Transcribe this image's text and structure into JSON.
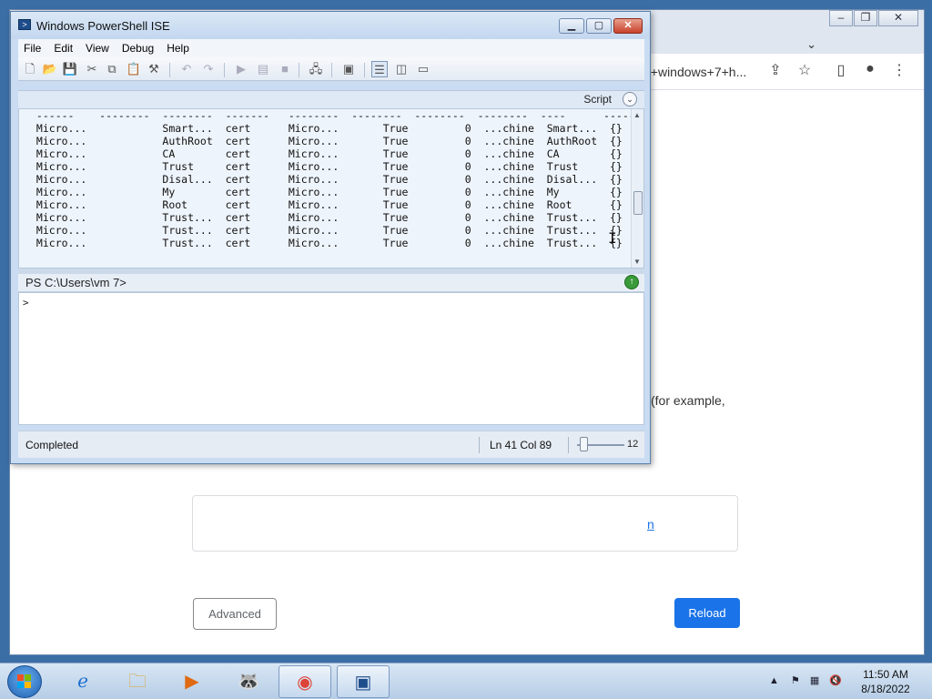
{
  "chrome": {
    "url_fragment": "n+windows+7+h...",
    "paragraph_fragment": "(for example,",
    "card_link_fragment": "n",
    "advanced_label": "Advanced",
    "reload_label": "Reload",
    "min_icon": "minimize-icon",
    "max_icon": "maximize-icon",
    "close_icon": "close-icon"
  },
  "ise": {
    "title": "Windows PowerShell ISE",
    "menu": [
      "File",
      "Edit",
      "View",
      "Debug",
      "Help"
    ],
    "script_label": "Script",
    "console_lines": [
      " ------    --------  --------  -------   --------  --------  --------  --------  ----      --------",
      " Micro...            Smart...  cert      Micro...       True         0  ...chine  Smart...  {}",
      " Micro...            AuthRoot  cert      Micro...       True         0  ...chine  AuthRoot  {}",
      " Micro...            CA        cert      Micro...       True         0  ...chine  CA        {}",
      " Micro...            Trust     cert      Micro...       True         0  ...chine  Trust     {}",
      " Micro...            Disal...  cert      Micro...       True         0  ...chine  Disal...  {}",
      " Micro...            My        cert      Micro...       True         0  ...chine  My        {}",
      " Micro...            Root      cert      Micro...       True         0  ...chine  Root      {}",
      " Micro...            Trust...  cert      Micro...       True         0  ...chine  Trust...  {}",
      " Micro...            Trust...  cert      Micro...       True         0  ...chine  Trust...  {}",
      " Micro...            Trust...  cert      Micro...       True         0  ...chine  Trust...  {}"
    ],
    "path": "PS C:\\Users\\vm 7>",
    "prompt": ">",
    "status": "Completed",
    "position": "Ln 41  Col 89",
    "zoom": "12"
  },
  "taskbar": {
    "time": "11:50 AM",
    "date": "8/18/2022",
    "apps": [
      "internet-explorer-icon",
      "file-explorer-icon",
      "media-player-icon",
      "raccoon-app-icon",
      "chrome-icon",
      "powershell-icon"
    ]
  }
}
